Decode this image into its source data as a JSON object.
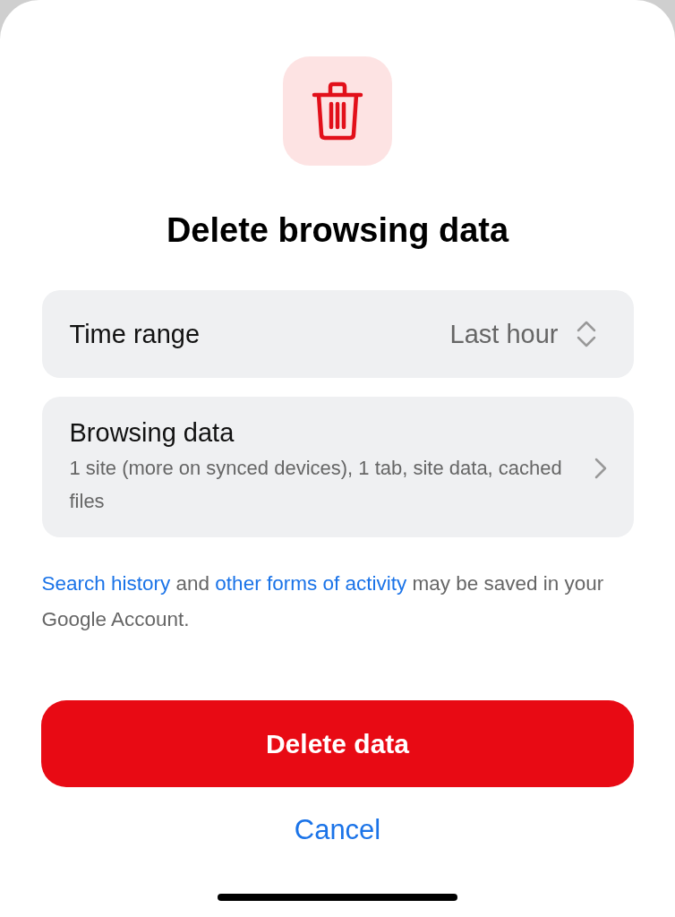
{
  "title": "Delete browsing data",
  "rows": [
    {
      "kind": "picker",
      "label": "Time range",
      "value": "Last hour"
    },
    {
      "kind": "link",
      "label": "Browsing data",
      "detail": "1 site (more on synced devices), 1 tab, site data, cached files"
    }
  ],
  "note": [
    {
      "kind": "link",
      "text": "Search history"
    },
    {
      "kind": "text",
      "text": " and "
    },
    {
      "kind": "link",
      "text": "other forms of activity"
    },
    {
      "kind": "text",
      "text": " may be saved in your Google Account."
    }
  ],
  "primary_button": "Delete data",
  "cancel_button": "Cancel"
}
